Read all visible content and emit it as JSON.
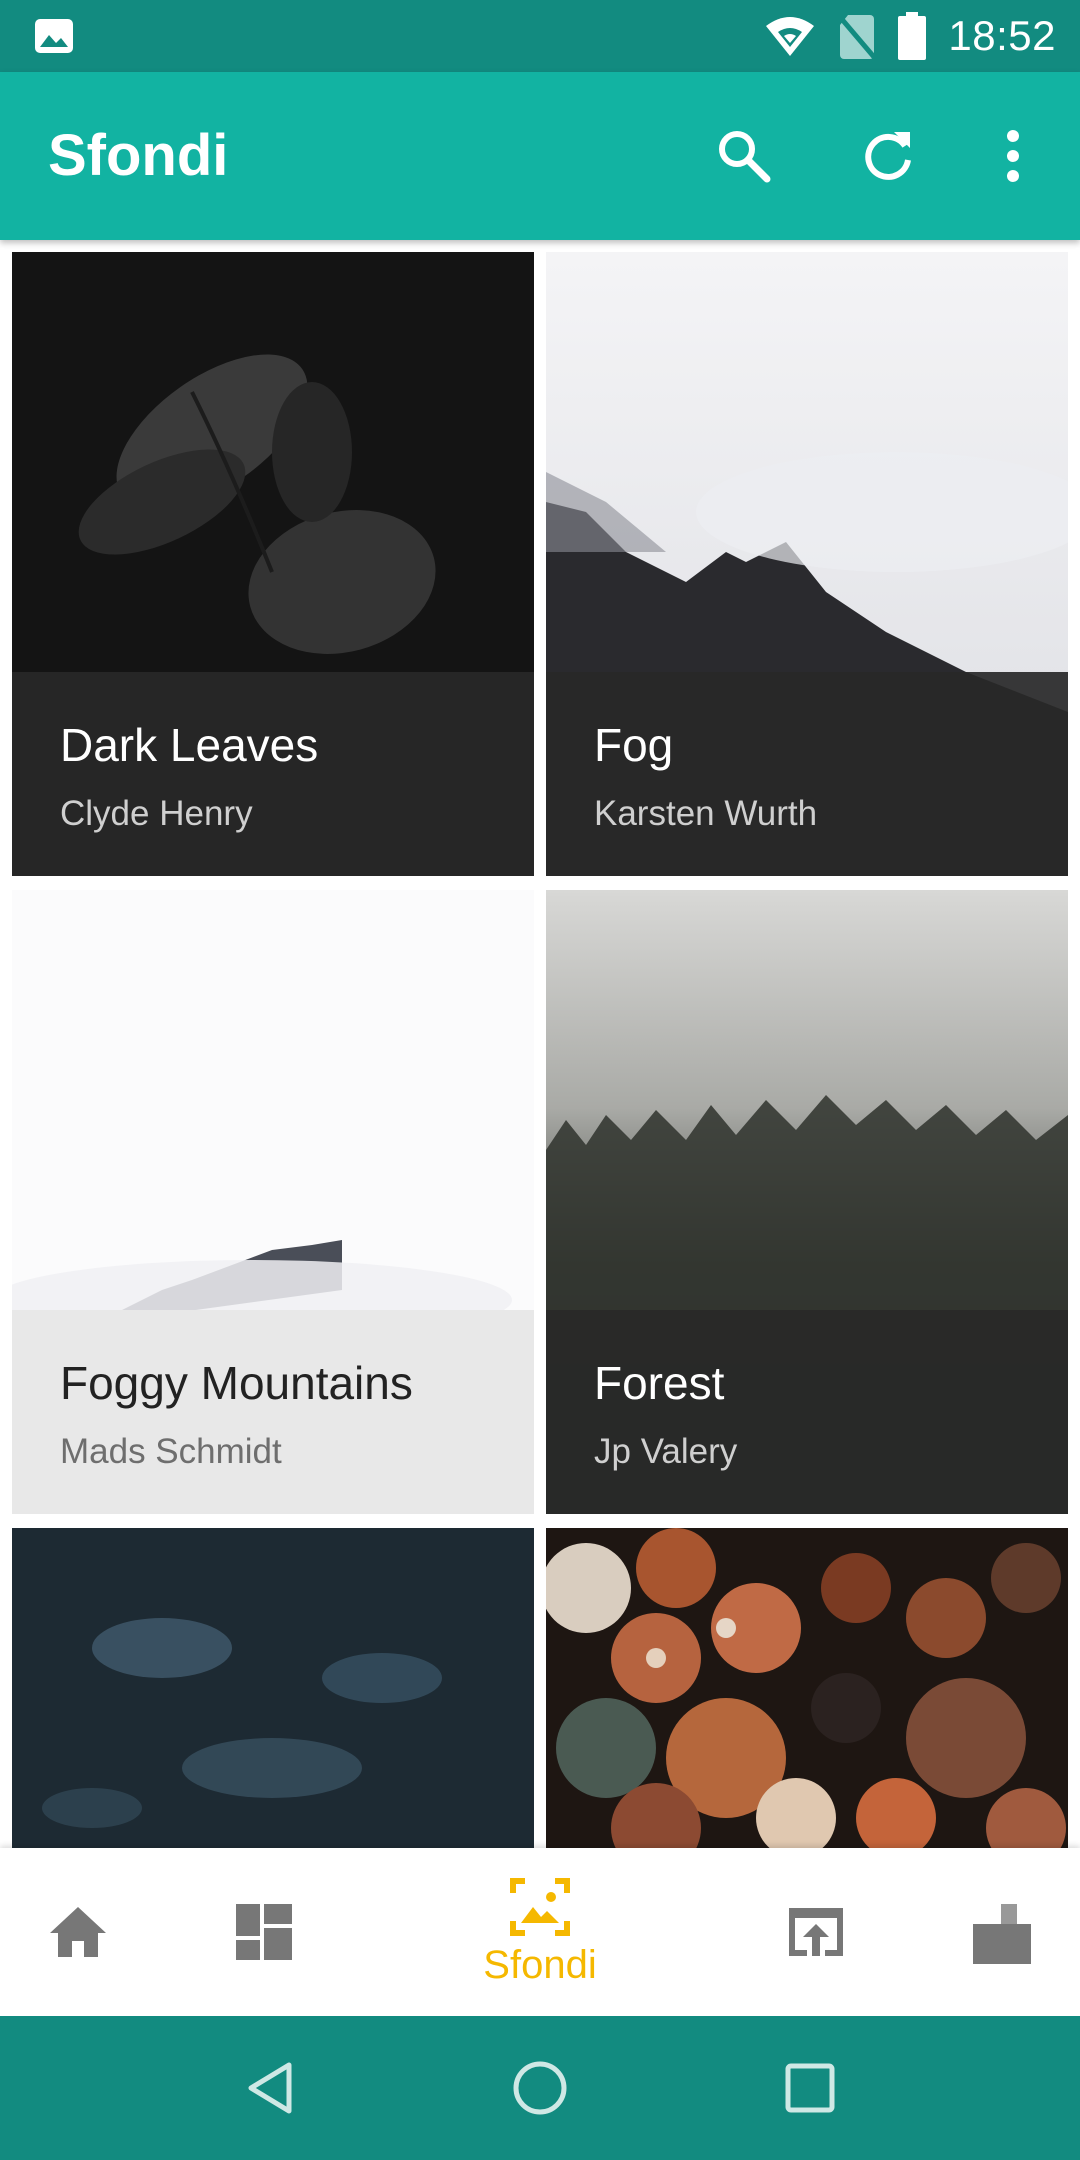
{
  "status_bar": {
    "time": "18:52",
    "icons": [
      "gallery-notification-icon",
      "wifi-icon",
      "no-sim-icon",
      "battery-icon"
    ]
  },
  "app_bar": {
    "title": "Sfondi",
    "actions": [
      "search-icon",
      "refresh-icon",
      "more-vert-icon"
    ]
  },
  "wallpapers": [
    {
      "name": "Dark Leaves",
      "author": "Clyde Henry"
    },
    {
      "name": "Fog",
      "author": "Karsten Wurth"
    },
    {
      "name": "Foggy Mountains",
      "author": "Mads Schmidt"
    },
    {
      "name": "Forest",
      "author": "Jp Valery"
    },
    {
      "name": "",
      "author": ""
    },
    {
      "name": "",
      "author": ""
    }
  ],
  "bottom_nav": {
    "items": [
      "home-icon",
      "dashboard-icon",
      "wallpapers-icon",
      "apply-icon",
      "requests-icon"
    ],
    "active_label": "Sfondi",
    "active_color": "#f5b800"
  },
  "colors": {
    "status_bar": "#128b80",
    "app_bar": "#12b3a2",
    "accent": "#f5b800"
  }
}
